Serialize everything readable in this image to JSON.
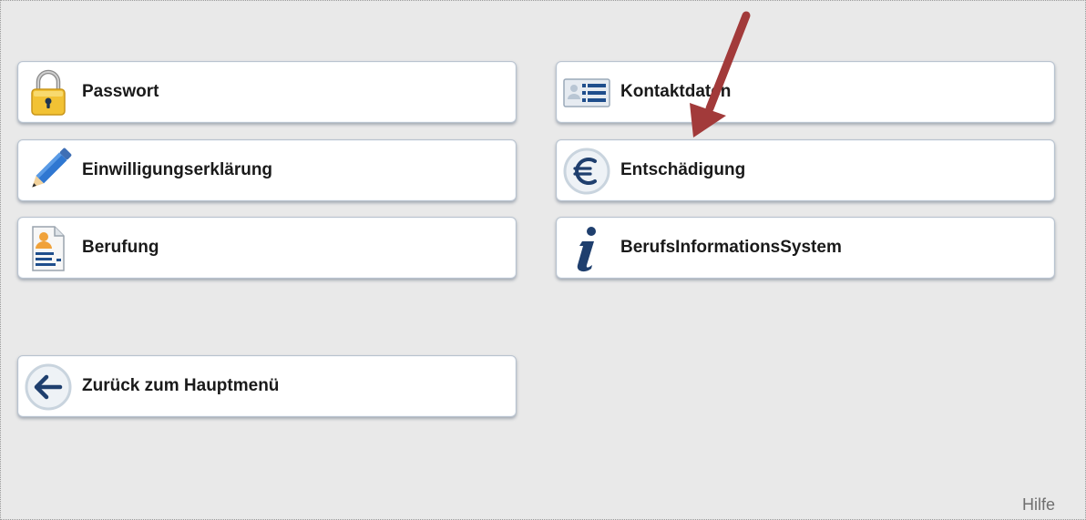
{
  "tiles": {
    "password": {
      "label": "Passwort",
      "icon": "lock-icon"
    },
    "consent": {
      "label": "Einwilligungserklärung",
      "icon": "pencil-icon"
    },
    "appointment": {
      "label": "Berufung",
      "icon": "person-document-icon"
    },
    "contact": {
      "label": "Kontaktdaten",
      "icon": "contact-card-icon"
    },
    "compensation": {
      "label": "Entschädigung",
      "icon": "euro-icon"
    },
    "info_system": {
      "label": "BerufsInformationsSystem",
      "icon": "info-icon"
    },
    "back": {
      "label": "Zurück zum Hauptmenü",
      "icon": "arrow-left-icon"
    }
  },
  "footer": {
    "help_label": "Hilfe"
  },
  "colors": {
    "background": "#e9e9e9",
    "tile_border": "#b9c3cf",
    "icon_blue": "#1f4e8c",
    "lock_yellow": "#f2c234",
    "annotation_arrow": "#a23a3a"
  }
}
